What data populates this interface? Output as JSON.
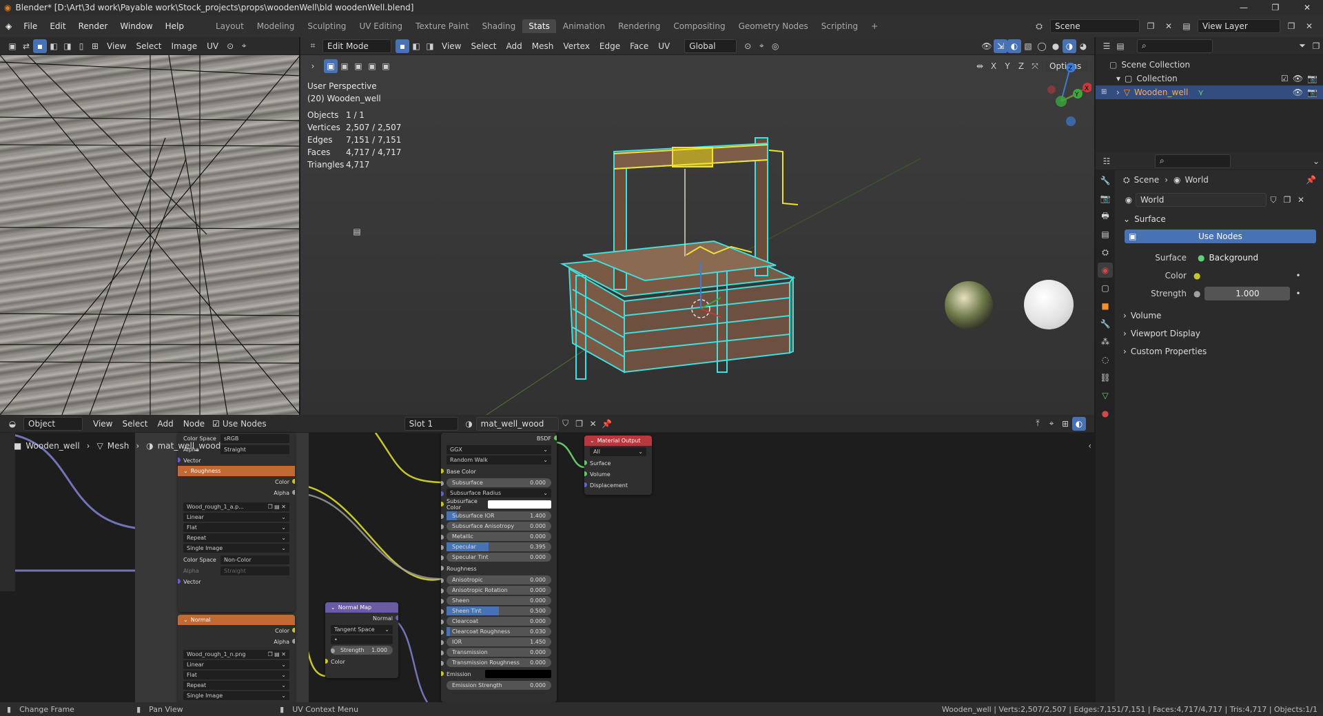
{
  "titlebar": {
    "title": "Blender* [D:\\Art\\3d work\\Payable work\\Stock_projects\\props\\woodenWell\\bld woodenWell.blend]",
    "minimize": "—",
    "maximize": "❐",
    "close": "✕"
  },
  "menu": [
    "File",
    "Edit",
    "Render",
    "Window",
    "Help"
  ],
  "workspaces": [
    "Layout",
    "Modeling",
    "Sculpting",
    "UV Editing",
    "Texture Paint",
    "Shading",
    "Stats",
    "Animation",
    "Rendering",
    "Compositing",
    "Geometry Nodes",
    "Scripting"
  ],
  "active_workspace": "Stats",
  "add_workspace": "+",
  "scene": "Scene",
  "view_layer": "View Layer",
  "image_editor": {
    "menus": [
      "View",
      "Select",
      "Image",
      "UV"
    ]
  },
  "viewport": {
    "mode": "Edit Mode",
    "menus": [
      "View",
      "Select",
      "Add",
      "Mesh",
      "Vertex",
      "Edge",
      "Face",
      "UV"
    ],
    "orientation": "Global",
    "options": "Options",
    "axes": [
      "X",
      "Y",
      "Z"
    ],
    "overlay_title": "User Perspective",
    "overlay_object": "(20) Wooden_well",
    "stats": [
      {
        "label": "Objects",
        "value": "1 / 1"
      },
      {
        "label": "Vertices",
        "value": "2,507 / 2,507"
      },
      {
        "label": "Edges",
        "value": "7,151 / 7,151"
      },
      {
        "label": "Faces",
        "value": "4,717 / 4,717"
      },
      {
        "label": "Triangles",
        "value": "4,717"
      }
    ]
  },
  "outliner": {
    "scene_collection": "Scene Collection",
    "collection": "Collection",
    "object": "Wooden_well"
  },
  "properties": {
    "breadcrumb": [
      "Scene",
      "World"
    ],
    "world_name": "World",
    "surface_section": "Surface",
    "use_nodes": "Use Nodes",
    "surface_label": "Surface",
    "surface_value": "Background",
    "color_label": "Color",
    "strength_label": "Strength",
    "strength_value": "1.000",
    "sections": [
      "Volume",
      "Viewport Display",
      "Custom Properties"
    ]
  },
  "node_editor": {
    "object_mode": "Object",
    "menus": [
      "View",
      "Select",
      "Add",
      "Node"
    ],
    "use_nodes": "Use Nodes",
    "slot": "Slot 1",
    "material": "mat_well_wood",
    "breadcrumb": [
      "Wooden_well",
      "Mesh",
      "mat_well_wood"
    ],
    "roughness_node": {
      "title": "Roughness",
      "out_color": "Color",
      "out_alpha": "Alpha",
      "image": "Wood_rough_1_a.p...",
      "interp": "Linear",
      "proj": "Flat",
      "ext": "Repeat",
      "source": "Single Image",
      "colorspace_label": "Color Space",
      "colorspace": "Non-Color",
      "alpha_label": "Alpha",
      "alpha": "Straight",
      "vector": "Vector",
      "top_colorspace": "sRGB",
      "top_alpha": "Straight",
      "top_vector": "Vector",
      "top_colorspace_label": "Color Space",
      "top_alpha_label": "Alpha"
    },
    "normal_node": {
      "title": "Normal",
      "out_color": "Color",
      "out_alpha": "Alpha",
      "image": "Wood_rough_1_n.png",
      "interp": "Linear",
      "proj": "Flat",
      "ext": "Repeat",
      "source": "Single Image"
    },
    "normalmap_node": {
      "title": "Normal Map",
      "out": "Normal",
      "space": "Tangent Space",
      "uv": "•",
      "strength_label": "Strength",
      "strength": "1.000",
      "color": "Color"
    },
    "bsdf": {
      "out": "BSDF",
      "distribution": "GGX",
      "sss_method": "Random Walk",
      "base_color": "Base Color",
      "rows": [
        {
          "label": "Subsurface",
          "value": "0.000",
          "fill": 0
        },
        {
          "label": "Subsurface Radius",
          "value": "",
          "fill": 0,
          "select": true
        },
        {
          "label": "Subsurface Color",
          "value": "",
          "fill": 0,
          "color": "#ffffff"
        },
        {
          "label": "Subsurface IOR",
          "value": "1.400",
          "fill": 0.1
        },
        {
          "label": "Subsurface Anisotropy",
          "value": "0.000",
          "fill": 0
        },
        {
          "label": "Metallic",
          "value": "0.000",
          "fill": 0
        },
        {
          "label": "Specular",
          "value": "0.395",
          "fill": 0.4
        },
        {
          "label": "Specular Tint",
          "value": "0.000",
          "fill": 0
        }
      ],
      "roughness": "Roughness",
      "rows2": [
        {
          "label": "Anisotropic",
          "value": "0.000",
          "fill": 0
        },
        {
          "label": "Anisotropic Rotation",
          "value": "0.000",
          "fill": 0
        },
        {
          "label": "Sheen",
          "value": "0.000",
          "fill": 0
        },
        {
          "label": "Sheen Tint",
          "value": "0.500",
          "fill": 0.5
        },
        {
          "label": "Clearcoat",
          "value": "0.000",
          "fill": 0
        },
        {
          "label": "Clearcoat Roughness",
          "value": "0.030",
          "fill": 0.03
        },
        {
          "label": "IOR",
          "value": "1.450",
          "fill": 0
        },
        {
          "label": "Transmission",
          "value": "0.000",
          "fill": 0
        },
        {
          "label": "Transmission Roughness",
          "value": "0.000",
          "fill": 0
        }
      ],
      "emission": "Emission",
      "emission_strength_label": "Emission Strength",
      "emission_strength": "0.000"
    },
    "output_node": {
      "title": "Material Output",
      "target": "All",
      "inputs": [
        "Surface",
        "Volume",
        "Displacement"
      ]
    }
  },
  "statusbar": {
    "left": [
      "Change Frame",
      "Pan View",
      "UV Context Menu"
    ],
    "right": "Wooden_well | Verts:2,507/2,507 | Edges:7,151/7,151 | Faces:4,717/4,717 | Tris:4,717 | Objects:1/1"
  },
  "colors": {
    "accent": "#4772b3",
    "header": "#303030",
    "roughness_header": "#c26a34",
    "normalmap_header": "#6b5aa6",
    "output_header": "#b8383d"
  }
}
